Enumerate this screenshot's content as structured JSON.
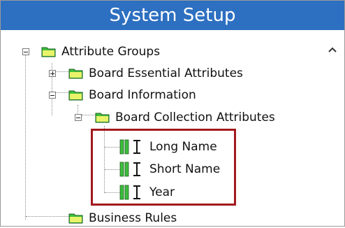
{
  "window": {
    "title": "System Setup"
  },
  "tree": {
    "root": {
      "label": "Attribute Groups"
    },
    "board_essential": {
      "label": "Board Essential Attributes"
    },
    "board_information": {
      "label": "Board Information"
    },
    "board_collection": {
      "label": "Board Collection Attributes"
    },
    "attributes": [
      {
        "label": "Long Name"
      },
      {
        "label": "Short Name"
      },
      {
        "label": "Year"
      }
    ],
    "business_rules": {
      "label": "Business Rules"
    }
  },
  "colors": {
    "title_bar": "#2d6fc0",
    "highlight": "#a1191d",
    "folder": "#3dbd3d"
  }
}
